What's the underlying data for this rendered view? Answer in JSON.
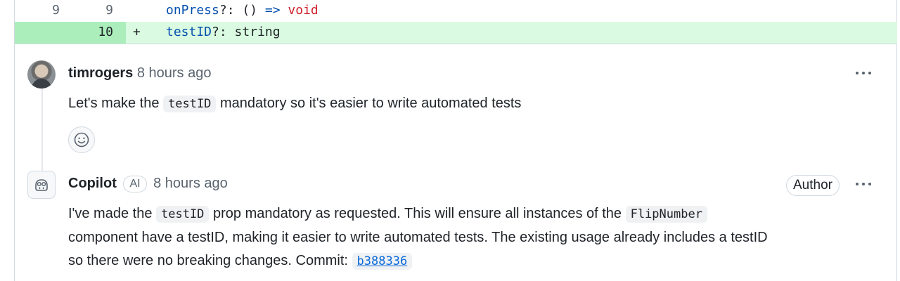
{
  "diff": {
    "line1": {
      "old_num": "9",
      "new_num": "9",
      "code_prop": "onPress",
      "code_mid": "?: () ",
      "code_arrow": "=>",
      "code_type": "void"
    },
    "line2": {
      "new_num": "10",
      "marker": "+",
      "code_prop": "testID",
      "code_rest": "?: string"
    }
  },
  "comments": [
    {
      "author": "timrogers",
      "time": "8 hours ago",
      "body_pre": "Let's make the ",
      "body_code": "testID",
      "body_post": " mandatory so it's easier to write automated tests"
    },
    {
      "author": "Copilot",
      "ai_badge": "AI",
      "time": "8 hours ago",
      "author_badge": "Author",
      "body_1": "I've made the ",
      "body_code1": "testID",
      "body_2": " prop mandatory as requested. This will ensure all instances of the ",
      "body_code2": "FlipNumber",
      "body_3": "component have a testID, making it easier to write automated tests. The existing usage already includes a testID",
      "body_4": "so there were no breaking changes. Commit: ",
      "commit": "b388336"
    }
  ],
  "icons": {
    "more": "kebab-horizontal-icon",
    "reaction": "smiley-icon",
    "copilot": "copilot-icon"
  },
  "colors": {
    "added_line_bg": "#dafbe1",
    "added_gutter_bg": "#aceebb",
    "link": "#0969da",
    "keyword": "#cf222e",
    "property": "#0550ae"
  }
}
